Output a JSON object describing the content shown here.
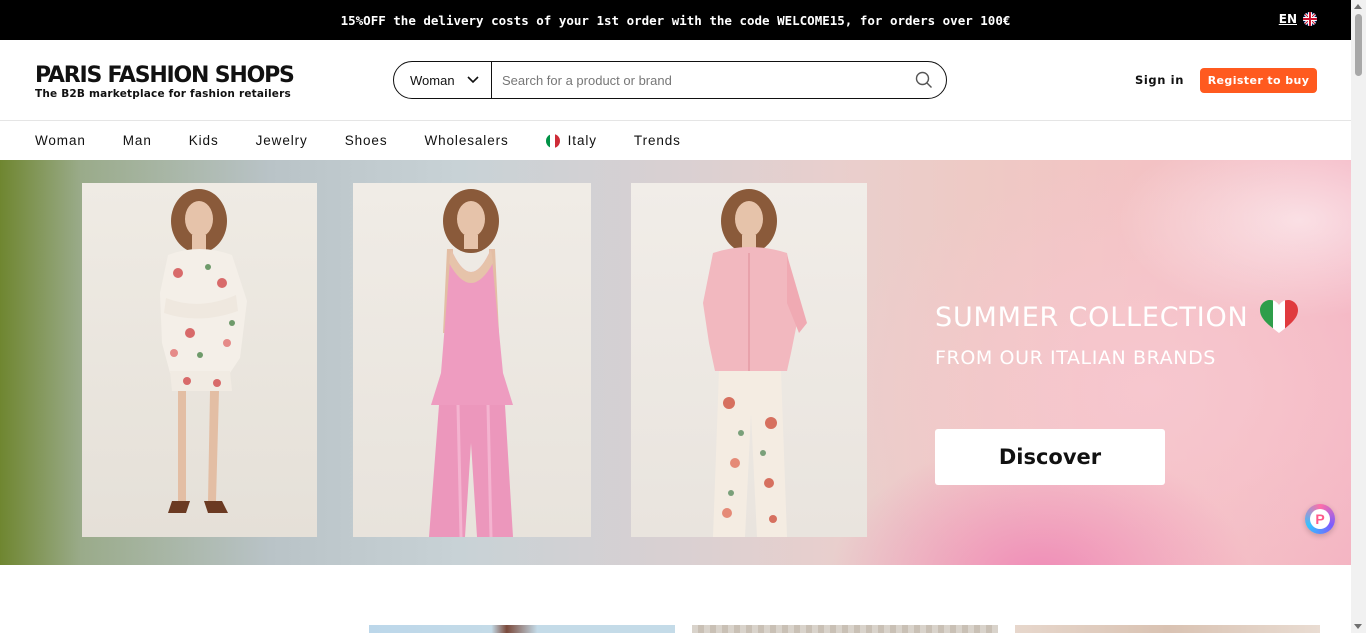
{
  "promo": {
    "text": "15%OFF the delivery costs of your 1st order with the code WELCOME15, for orders over 100€",
    "language": "EN",
    "language_icon": "uk-flag-icon"
  },
  "header": {
    "logo_title": "PARIS FASHION SHOPS",
    "logo_subtitle": "The B2B marketplace for fashion retailers",
    "search": {
      "category": "Woman",
      "placeholder": "Search for a product or brand",
      "value": ""
    },
    "sign_in": "Sign in",
    "register": "Register to buy",
    "accent_color": "#ff5a1f"
  },
  "nav": {
    "items": [
      {
        "label": "Woman"
      },
      {
        "label": "Man"
      },
      {
        "label": "Kids"
      },
      {
        "label": "Jewelry"
      },
      {
        "label": "Shoes"
      },
      {
        "label": "Wholesalers"
      },
      {
        "label": "Italy",
        "icon": "italy-flag-icon"
      },
      {
        "label": "Trends"
      }
    ]
  },
  "hero": {
    "title": "SUMMER COLLECTION",
    "subtitle": "FROM OUR ITALIAN BRANDS",
    "button": "Discover",
    "title_icon": "italy-heart-icon"
  }
}
